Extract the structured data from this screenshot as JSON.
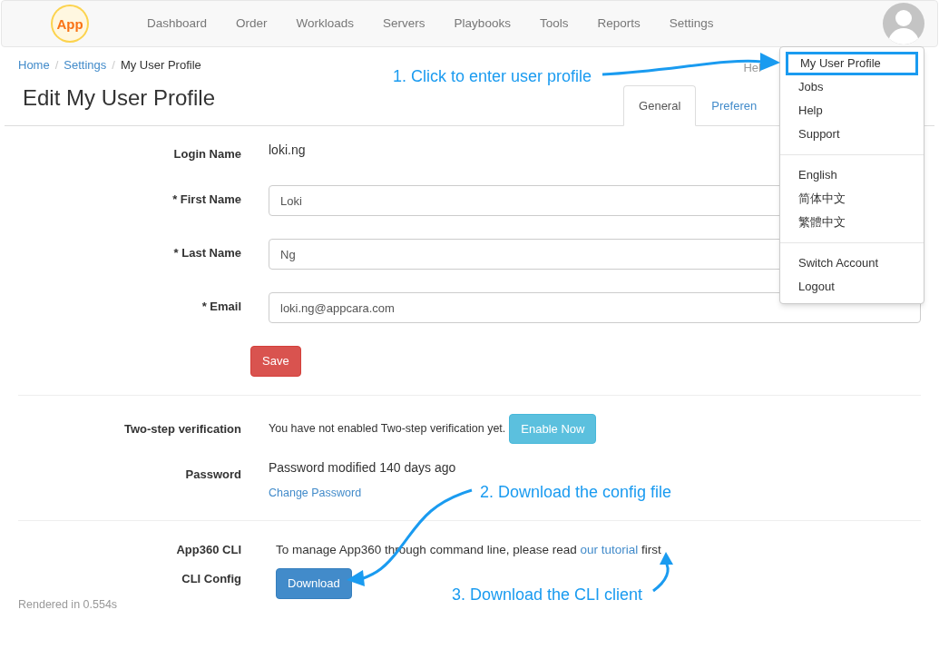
{
  "navbar": {
    "logo_text": "App",
    "items": [
      {
        "label": "Dashboard"
      },
      {
        "label": "Order"
      },
      {
        "label": "Workloads"
      },
      {
        "label": "Servers"
      },
      {
        "label": "Playbooks"
      },
      {
        "label": "Tools"
      },
      {
        "label": "Reports"
      },
      {
        "label": "Settings"
      }
    ]
  },
  "breadcrumb": {
    "separator": "/",
    "items": [
      {
        "label": "Home",
        "link": true
      },
      {
        "label": "Settings",
        "link": true
      },
      {
        "label": "My User Profile",
        "link": false
      }
    ]
  },
  "help_link": "Hel",
  "page_title": "Edit My User Profile",
  "tabs": [
    {
      "label": "General",
      "selected": true
    },
    {
      "label": "Preferen",
      "selected": false
    }
  ],
  "login_name": {
    "label": "Login Name",
    "value": "loki.ng"
  },
  "fields": [
    {
      "label": "* First Name",
      "value": "Loki"
    },
    {
      "label": "* Last Name",
      "value": "Ng"
    },
    {
      "label": "* Email",
      "value": "loki.ng@appcara.com"
    }
  ],
  "save_button": "Save",
  "two_step": {
    "label": "Two-step verification",
    "text": "You have not enabled Two-step verification yet.",
    "button": "Enable Now"
  },
  "password": {
    "label": "Password",
    "text": "Password modified 140 days ago",
    "link": "Change Password"
  },
  "cli": {
    "label": "App360 CLI",
    "text_before": "To manage App360 through command line, please read",
    "link": "our tutorial",
    "text_after": "first"
  },
  "cli_config": {
    "label": "CLI Config",
    "button": "Download"
  },
  "footer": "Rendered in 0.554s",
  "user_menu": {
    "groups": [
      [
        {
          "label": "My User Profile",
          "highlighted": true
        },
        {
          "label": "Jobs",
          "highlighted": false
        },
        {
          "label": "Help",
          "highlighted": false
        },
        {
          "label": "Support",
          "highlighted": false
        }
      ],
      [
        {
          "label": "English",
          "highlighted": false
        },
        {
          "label": "简体中文",
          "highlighted": false
        },
        {
          "label": "繁體中文",
          "highlighted": false
        }
      ],
      [
        {
          "label": "Switch Account",
          "highlighted": false
        },
        {
          "label": "Logout",
          "highlighted": false
        }
      ]
    ]
  },
  "annotations": [
    "1. Click to enter user profile",
    "2. Download the config file",
    "3. Download the CLI client"
  ]
}
